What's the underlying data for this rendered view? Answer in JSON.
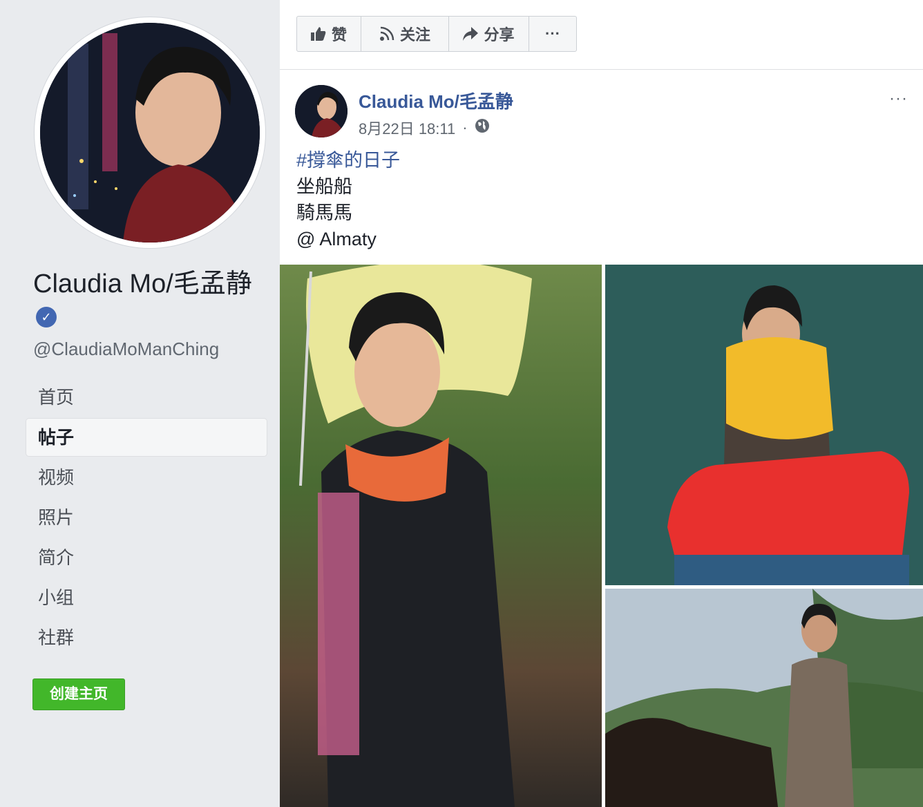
{
  "profile": {
    "name": "Claudia Mo/毛孟静",
    "handle": "@ClaudiaMoManChing"
  },
  "nav": {
    "items": [
      {
        "label": "首页",
        "active": false
      },
      {
        "label": "帖子",
        "active": true
      },
      {
        "label": "视频",
        "active": false
      },
      {
        "label": "照片",
        "active": false
      },
      {
        "label": "简介",
        "active": false
      },
      {
        "label": "小组",
        "active": false
      },
      {
        "label": "社群",
        "active": false
      }
    ],
    "create_page_label": "创建主页"
  },
  "action_bar": {
    "like_label": "赞",
    "follow_label": "关注",
    "share_label": "分享",
    "more_label": "···"
  },
  "post": {
    "author": "Claudia Mo/毛孟静",
    "date": "8月22日 18:11",
    "dot": "·",
    "more_label": "···",
    "hashtag": "#撐傘的日子",
    "line1": "坐船船",
    "line2": "騎馬馬",
    "location": "@ Almaty"
  },
  "colors": {
    "link_blue": "#385898",
    "verified_blue": "#4267b2",
    "create_green": "#42b72a",
    "page_bg": "#e9ebee"
  },
  "icons": [
    "thumbs-up-icon",
    "rss-follow-icon",
    "share-arrow-icon",
    "globe-icon",
    "verified-badge-icon"
  ]
}
